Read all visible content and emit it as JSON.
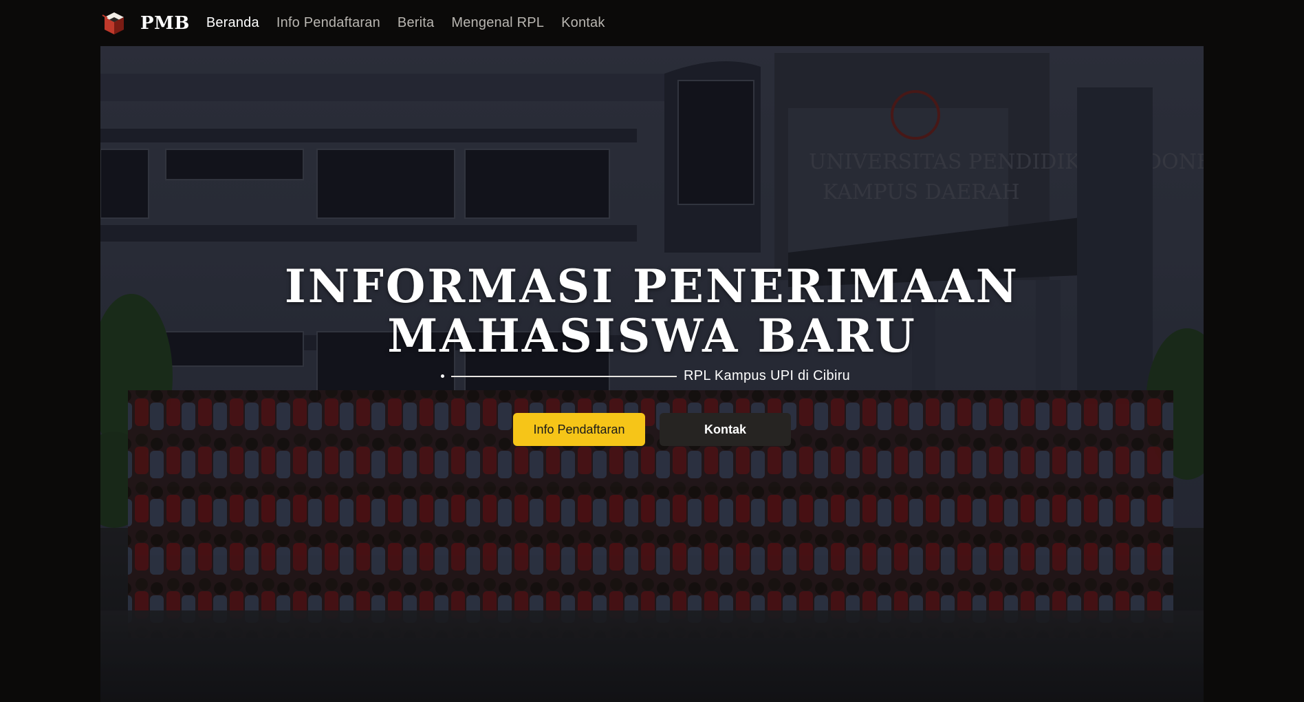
{
  "brand": {
    "name": "PMB"
  },
  "nav": {
    "items": [
      {
        "label": "Beranda",
        "active": true
      },
      {
        "label": "Info Pendaftaran",
        "active": false
      },
      {
        "label": "Berita",
        "active": false
      },
      {
        "label": "Mengenal RPL",
        "active": false
      },
      {
        "label": "Kontak",
        "active": false
      }
    ]
  },
  "hero": {
    "title_line1": "INFORMASI PENERIMAAN",
    "title_line2": "MAHASISWA BARU",
    "subtitle": "RPL Kampus UPI di Cibiru",
    "primary_button": "Info Pendaftaran",
    "secondary_button": "Kontak",
    "background_sign_line1": "UNIVERSITAS PENDIDIKAN INDONESIA",
    "background_sign_line2": "KAMPUS DAERAH"
  },
  "colors": {
    "page_bg": "#0b0a09",
    "accent": "#f6c518",
    "secondary_button": "#262422",
    "nav_active": "#ffffff",
    "nav_inactive": "#b9b6b1"
  }
}
